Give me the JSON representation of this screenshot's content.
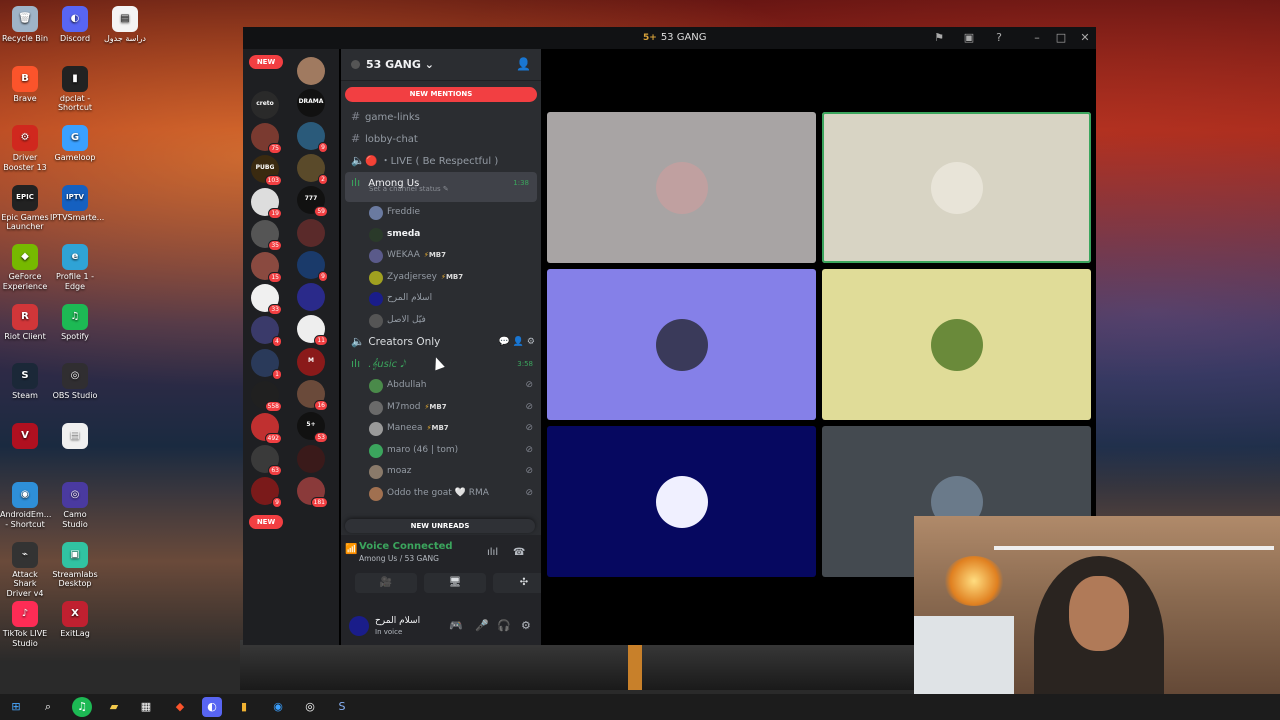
{
  "desktop": {
    "icons_left": [
      {
        "label": "Recycle Bin",
        "color": "#9fb4c8",
        "glyph": "🗑"
      },
      {
        "label": "Brave",
        "color": "#fb542b",
        "glyph": "B"
      },
      {
        "label": "Driver Booster 13",
        "color": "#d0281e",
        "glyph": "⚙"
      },
      {
        "label": "Epic Games Launcher",
        "color": "#222222",
        "glyph": "EPIC"
      },
      {
        "label": "GeForce Experience",
        "color": "#76b900",
        "glyph": "◆"
      },
      {
        "label": "Riot Client",
        "color": "#d13639",
        "glyph": "R"
      },
      {
        "label": "Steam",
        "color": "#1b2838",
        "glyph": "S"
      },
      {
        "label": "",
        "color": "#b01020",
        "glyph": "V"
      },
      {
        "label": "AndroidEm... - Shortcut",
        "color": "#2e8fd8",
        "glyph": "◉"
      },
      {
        "label": "Attack Shark Driver v4",
        "color": "#333333",
        "glyph": "⌁"
      },
      {
        "label": "TikTok LIVE Studio",
        "color": "#fe2c55",
        "glyph": "♪"
      }
    ],
    "icons_right": [
      {
        "label": "Discord",
        "color": "#5865f2",
        "glyph": "◐"
      },
      {
        "label": "dpclat - Shortcut",
        "color": "#222222",
        "glyph": "▮"
      },
      {
        "label": "Gameloop",
        "color": "#3aa0ff",
        "glyph": "G"
      },
      {
        "label": "IPTVSmarte...",
        "color": "#1560c0",
        "glyph": "IPTV"
      },
      {
        "label": "Profile 1 - Edge",
        "color": "#2fa3d6",
        "glyph": "e"
      },
      {
        "label": "Spotify",
        "color": "#1db954",
        "glyph": "♫"
      },
      {
        "label": "OBS Studio",
        "color": "#302e31",
        "glyph": "◎"
      },
      {
        "label": "",
        "color": "#f0f0f0",
        "glyph": "▤"
      },
      {
        "label": "Camo Studio",
        "color": "#4a3aa0",
        "glyph": "◎"
      },
      {
        "label": "Streamlabs Desktop",
        "color": "#31c3a2",
        "glyph": "▣"
      },
      {
        "label": "ExitLag",
        "color": "#c02030",
        "glyph": "X"
      }
    ],
    "doc_label": "دراسة جدول"
  },
  "window": {
    "title": "53 GANG",
    "title_badge": "5+"
  },
  "guilds": {
    "new_top": "NEW",
    "new_bottom": "NEW",
    "col1": [
      {
        "color": "#2a2a2a",
        "count": "",
        "label": "creto"
      },
      {
        "color": "#7a3a30",
        "count": "75",
        "label": ""
      },
      {
        "color": "#3a2a10",
        "count": "103",
        "label": "PUBG"
      },
      {
        "color": "#ddd",
        "count": "19",
        "label": ""
      },
      {
        "color": "#555",
        "count": "35",
        "label": ""
      },
      {
        "color": "#8a4a40",
        "count": "15",
        "label": ""
      },
      {
        "color": "#f0f0f0",
        "count": "33",
        "label": ""
      },
      {
        "color": "#3a3a6a",
        "count": "4",
        "label": ""
      },
      {
        "color": "#2a3a5a",
        "count": "1",
        "label": ""
      },
      {
        "color": "#202020",
        "count": "558",
        "label": ""
      },
      {
        "color": "#c03030",
        "count": "492",
        "label": ""
      },
      {
        "color": "#3a3a3a",
        "count": "63",
        "label": ""
      },
      {
        "color": "#7a1a1a",
        "count": "9",
        "label": ""
      }
    ],
    "col2": [
      {
        "color": "#a07a60",
        "count": "",
        "label": ""
      },
      {
        "color": "#111",
        "count": "",
        "label": "DRAMA"
      },
      {
        "color": "#2a5a7a",
        "count": "9",
        "label": ""
      },
      {
        "color": "#5a4a2a",
        "count": "2",
        "label": ""
      },
      {
        "color": "#111",
        "count": "59",
        "label": "777"
      },
      {
        "color": "#5a2a2a",
        "count": "",
        "label": ""
      },
      {
        "color": "#1a3a6a",
        "count": "9",
        "label": ""
      },
      {
        "color": "#2a2a8a",
        "count": "",
        "label": ""
      },
      {
        "color": "#eee",
        "count": "11",
        "label": ""
      },
      {
        "color": "#8a1a1a",
        "count": "",
        "label": "M"
      },
      {
        "color": "#6a4a3a",
        "count": "16",
        "label": ""
      },
      {
        "color": "#111",
        "count": "53",
        "label": "5+"
      },
      {
        "color": "#3a1a1a",
        "count": "",
        "label": ""
      },
      {
        "color": "#8a3a3a",
        "count": "181",
        "label": ""
      }
    ]
  },
  "server": {
    "name": "53 GANG ⌄",
    "new_mentions": "NEW MENTIONS",
    "new_unreads": "NEW UNREADS",
    "channels": [
      {
        "icon": "#",
        "name": "game-links",
        "type": "text"
      },
      {
        "icon": "#",
        "name": "lobby-chat",
        "type": "text"
      },
      {
        "icon": "🔈",
        "name": "🔴 ・LIVE ( Be Respectful )",
        "type": "voice"
      }
    ],
    "among_us": {
      "name": "Among Us",
      "time": "1:38",
      "status": "Set a channel status ✎",
      "members": [
        {
          "name": "Freddie",
          "tag": "",
          "bold": false,
          "color": "#6a7aa0"
        },
        {
          "name": "smeda",
          "tag": "",
          "bold": true,
          "color": "#2a3a2a"
        },
        {
          "name": "WEKAA",
          "tag": "MB7",
          "bold": false,
          "color": "#5a5a8a"
        },
        {
          "name": "Zyadjersey",
          "tag": "MB7",
          "bold": false,
          "color": "#a0a020"
        },
        {
          "name": "اسلام المرح",
          "tag": "",
          "bold": false,
          "color": "#1a1d8a"
        },
        {
          "name": "فيّل الاصل",
          "tag": "",
          "bold": false,
          "color": "#555"
        }
      ]
    },
    "creators_only": {
      "name": "Creators Only",
      "actions": "💬 👤 ⚙"
    },
    "music": {
      "name": ".𝄞usic 𝅘𝅥𝅮",
      "time": "3:58",
      "members": [
        {
          "name": "Abdullah",
          "tag": "",
          "color": "#4a8a4a"
        },
        {
          "name": "M7mod",
          "tag": "MB7",
          "color": "#6a6a6a"
        },
        {
          "name": "Maneea",
          "tag": "MB7",
          "color": "#9a9a9a"
        },
        {
          "name": "maro (46 | tom)",
          "tag": "",
          "color": "#3ba55d"
        },
        {
          "name": "moaz",
          "tag": "",
          "color": "#8a7a6a"
        },
        {
          "name": "Oddo the goat 🤍 RMA",
          "tag": "",
          "color": "#a07050"
        }
      ]
    }
  },
  "voice": {
    "status": "Voice Connected",
    "location": "Among Us / 53 GANG",
    "buttons": [
      "🎥",
      "🖥",
      "✣",
      "🚀"
    ]
  },
  "user": {
    "name": "اسلام المرح",
    "status": "In voice"
  },
  "tiles": [
    {
      "bg": "#a8a4a4",
      "pic": "#c0a0a0",
      "speaking": false
    },
    {
      "bg": "#d8d4c4",
      "pic": "#e8e4d8",
      "speaking": true
    },
    {
      "bg": "#8580e8",
      "pic": "#3a3a5a",
      "speaking": false
    },
    {
      "bg": "#e0dc98",
      "pic": "#6a8a3a",
      "speaking": false
    },
    {
      "bg": "#060860",
      "pic": "#f0f0ff",
      "speaking": false
    },
    {
      "bg": "#444a50",
      "pic": "#6a7a8a",
      "speaking": false
    }
  ]
}
